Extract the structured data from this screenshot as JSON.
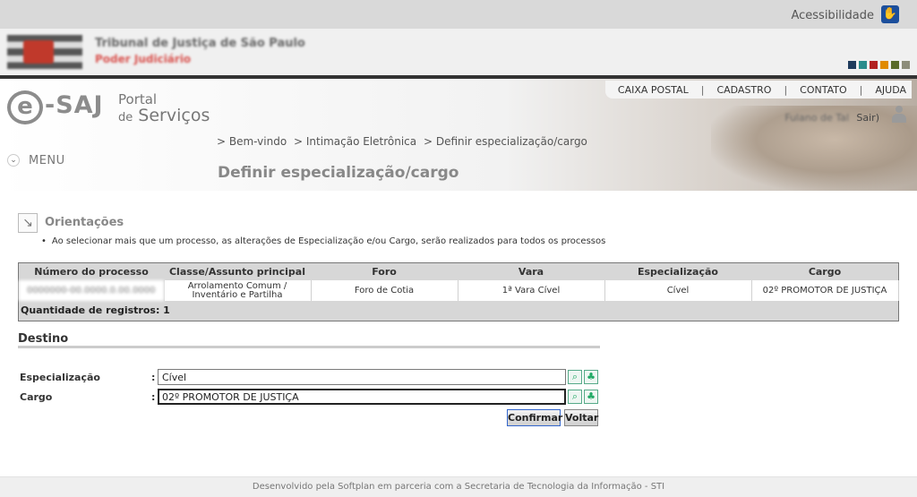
{
  "topbar": {
    "accessibility_label": "Acessibilidade"
  },
  "court": {
    "name": "Tribunal de Justiça de São Paulo",
    "subtitle": "Poder Judiciário",
    "swatch_colors": [
      "#1f3b5c",
      "#2a8b8b",
      "#b22222",
      "#e08a00",
      "#5a6b2a",
      "#8c8c7a"
    ]
  },
  "brand": {
    "logo_e": "e",
    "logo_saj": "-SAJ",
    "logo_portal": "Portal",
    "logo_de": "de",
    "logo_servicos": "Serviços"
  },
  "topnav": {
    "items": [
      "CAIXA POSTAL",
      "CADASTRO",
      "CONTATO",
      "AJUDA"
    ],
    "separator": "|"
  },
  "user": {
    "name": "Fulano de Tal",
    "logout_label": "Sair)"
  },
  "breadcrumb": {
    "items": [
      "> Bem-vindo",
      "> Intimação Eletrônica",
      "> Definir especialização/cargo"
    ]
  },
  "menu": {
    "label": "MENU"
  },
  "page": {
    "title": "Definir especialização/cargo"
  },
  "orientacoes": {
    "title": "Orientações",
    "bullet": "Ao selecionar mais que um processo, as alterações de Especialização e/ou Cargo, serão realizados para todos os processos"
  },
  "table": {
    "headers": [
      "Número do processo",
      "Classe/Assunto principal",
      "Foro",
      "Vara",
      "Especialização",
      "Cargo"
    ],
    "rows": [
      [
        "0000000-00.0000.0.00.0000",
        "Arrolamento Comum / Inventário e Partilha",
        "Foro de Cotia",
        "1ª Vara Cível",
        "Cível",
        "02º PROMOTOR DE JUSTIÇA"
      ]
    ],
    "quantity_label": "Quantidade de registros: 1"
  },
  "destino": {
    "title": "Destino",
    "especializacao_label": "Especialização",
    "especializacao_value": "Cível",
    "cargo_label": "Cargo",
    "cargo_value": "02º PROMOTOR DE JUSTIÇA",
    "colon": ":"
  },
  "buttons": {
    "confirm": "Confirmar",
    "back": "Voltar"
  },
  "footer": {
    "text": "Desenvolvido pela Softplan em parceria com a Secretaria de Tecnologia da Informação - STI"
  }
}
